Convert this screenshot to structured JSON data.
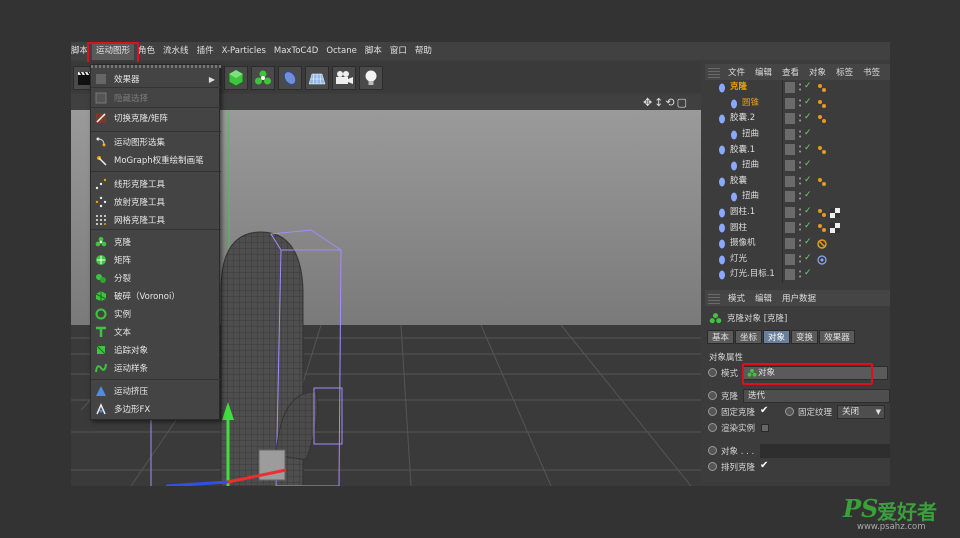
{
  "menubar": {
    "items": [
      "脚本",
      "运动图形",
      "角色",
      "流水线",
      "插件",
      "X-Particles",
      "MaxToC4D",
      "Octane",
      "脚本",
      "窗口",
      "帮助"
    ],
    "active_index": 1
  },
  "dropdown": {
    "items": [
      {
        "label": "效果器",
        "icon": "effector-icon",
        "submenu": true
      },
      {
        "label": "隐藏选择",
        "icon": "hide-selection-icon",
        "disabled": true
      },
      {
        "label": "切换克隆/矩阵",
        "icon": "toggle-clone-icon"
      },
      {
        "label": "运动图形选集",
        "icon": "mograph-selection-icon"
      },
      {
        "label": "MoGraph权重绘制画笔",
        "icon": "weight-brush-icon"
      },
      {
        "label": "线形克隆工具",
        "icon": "linear-clone-tool-icon"
      },
      {
        "label": "放射克隆工具",
        "icon": "radial-clone-tool-icon"
      },
      {
        "label": "网格克隆工具",
        "icon": "grid-clone-tool-icon"
      },
      {
        "label": "克隆",
        "icon": "cloner-icon"
      },
      {
        "label": "矩阵",
        "icon": "matrix-icon"
      },
      {
        "label": "分裂",
        "icon": "fracture-icon"
      },
      {
        "label": "破碎（Voronoi）",
        "icon": "voronoi-icon"
      },
      {
        "label": "实例",
        "icon": "instance-icon"
      },
      {
        "label": "文本",
        "icon": "text-icon"
      },
      {
        "label": "追踪对象",
        "icon": "tracer-icon"
      },
      {
        "label": "运动样条",
        "icon": "mospline-icon"
      },
      {
        "label": "运动挤压",
        "icon": "moextrude-icon"
      },
      {
        "label": "多边形FX",
        "icon": "polyfx-icon"
      }
    ]
  },
  "objmgr": {
    "tabs": [
      "文件",
      "编辑",
      "查看",
      "对象",
      "标签",
      "书签"
    ],
    "rows": [
      {
        "name": "克隆",
        "style": "sel",
        "indent": 0,
        "tags": [
          "mograph"
        ]
      },
      {
        "name": "圆锥",
        "style": "orange",
        "indent": 1,
        "tags": [
          "phong"
        ]
      },
      {
        "name": "胶囊.2",
        "style": "",
        "indent": 0,
        "tags": [
          "phong"
        ]
      },
      {
        "name": "扭曲",
        "style": "",
        "indent": 1,
        "tags": []
      },
      {
        "name": "胶囊.1",
        "style": "",
        "indent": 0,
        "tags": [
          "phong"
        ]
      },
      {
        "name": "扭曲",
        "style": "",
        "indent": 1,
        "tags": []
      },
      {
        "name": "胶囊",
        "style": "",
        "indent": 0,
        "tags": [
          "phong"
        ]
      },
      {
        "name": "扭曲",
        "style": "",
        "indent": 1,
        "tags": []
      },
      {
        "name": "圆柱.1",
        "style": "",
        "indent": 0,
        "tags": [
          "phong",
          "checker"
        ]
      },
      {
        "name": "圆柱",
        "style": "",
        "indent": 0,
        "tags": [
          "phong",
          "checker"
        ]
      },
      {
        "name": "摄像机",
        "style": "",
        "indent": 0,
        "tags": [
          "protect"
        ]
      },
      {
        "name": "灯光",
        "style": "",
        "indent": 0,
        "tags": [
          "target"
        ]
      },
      {
        "name": "灯光.目标.1",
        "style": "",
        "indent": 0,
        "tags": []
      }
    ]
  },
  "attrmgr": {
    "tabs": [
      "模式",
      "编辑",
      "用户数据"
    ],
    "object_title": "克隆对象 [克隆]",
    "subtabs": [
      "基本",
      "坐标",
      "对象",
      "变换",
      "效果器"
    ],
    "active_subtab": 2,
    "section_title": "对象属性",
    "mode_label": "模式",
    "mode_value": "对象",
    "clones_label": "克隆",
    "clones_value": "迭代",
    "fix_clone_label": "固定克隆",
    "fix_texture_label": "固定纹理",
    "fix_texture_value": "关闭",
    "render_instances_label": "渲染实例",
    "object_label": "对象 . . .",
    "arrange_clones_label": "排列克隆"
  },
  "watermark": {
    "brand": "PS",
    "cn": "爱好者",
    "url": "www.psahz.com"
  },
  "colors": {
    "highlight_red": "#e0101a",
    "selected_orange": "#f0a000",
    "active_tab": "#6a7f9b"
  }
}
